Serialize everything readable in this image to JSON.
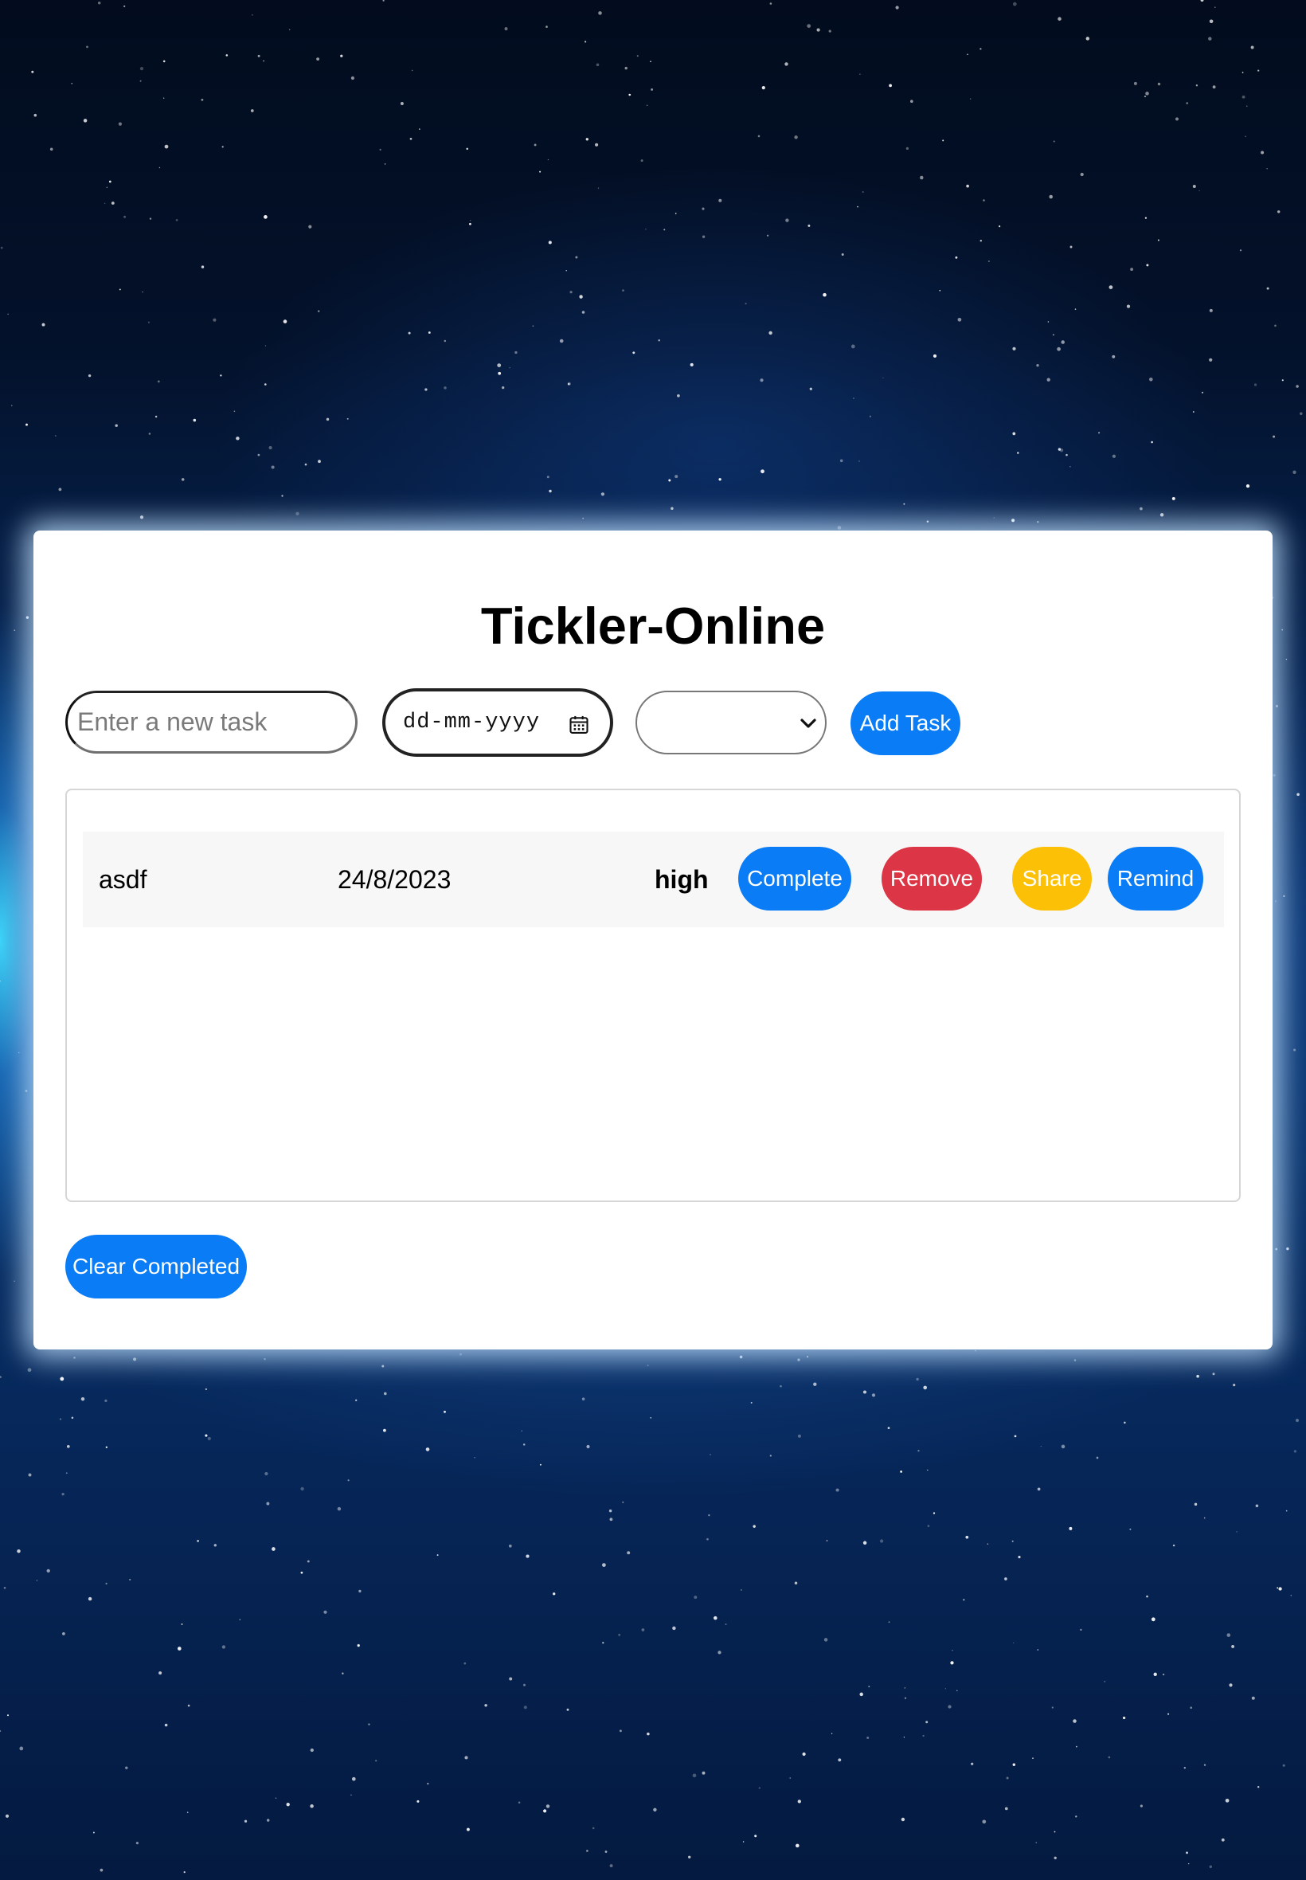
{
  "app": {
    "title": "Tickler-Online"
  },
  "form": {
    "task_placeholder": "Enter a new task",
    "task_value": "",
    "date_placeholder": "dd-mm-yyyy",
    "priority_selected": "",
    "add_label": "Add Task"
  },
  "tasks": [
    {
      "name": "asdf",
      "date": "24/8/2023",
      "priority": "high",
      "complete_label": "Complete",
      "remove_label": "Remove",
      "share_label": "Share",
      "remind_label": "Remind"
    }
  ],
  "footer": {
    "clear_label": "Clear Completed"
  },
  "colors": {
    "primary": "#0a7cf5",
    "danger": "#dc3545",
    "warning": "#fcc107",
    "card_background": "#ffffff",
    "row_background": "#f7f7f7"
  },
  "icons": {
    "date_picker": "calendar-icon",
    "select_arrow": "chevron-down-icon"
  }
}
